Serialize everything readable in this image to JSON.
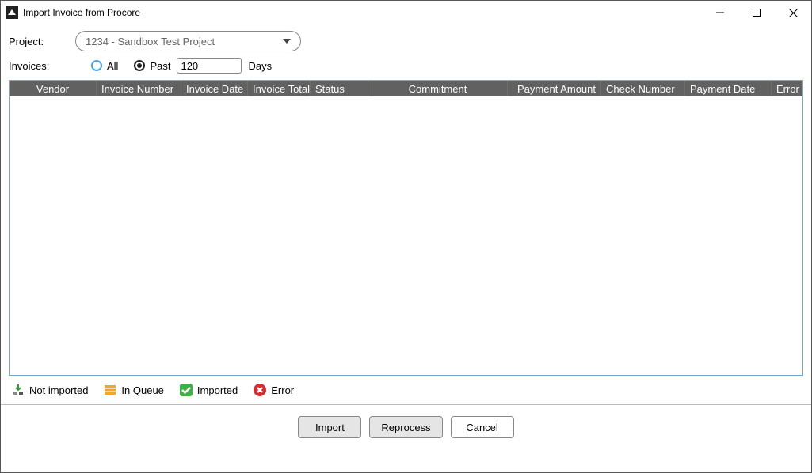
{
  "window": {
    "title": "Import Invoice from Procore"
  },
  "form": {
    "project_label": "Project:",
    "project_selected": "1234 - Sandbox Test Project",
    "invoices_label": "Invoices:",
    "radio_all_label": "All",
    "radio_past_label": "Past",
    "days_value": "120",
    "days_suffix": "Days",
    "radio_selected": "past"
  },
  "table": {
    "columns": {
      "vendor": "Vendor",
      "invoice_number": "Invoice Number",
      "invoice_date": "Invoice Date",
      "invoice_total": "Invoice Total",
      "status": "Status",
      "commitment": "Commitment",
      "payment_amount": "Payment Amount",
      "check_number": "Check Number",
      "payment_date": "Payment Date",
      "error": "Error"
    },
    "rows": []
  },
  "legend": {
    "not_imported": "Not imported",
    "in_queue": "In Queue",
    "imported": "Imported",
    "error": "Error"
  },
  "buttons": {
    "import": "Import",
    "reprocess": "Reprocess",
    "cancel": "Cancel"
  }
}
